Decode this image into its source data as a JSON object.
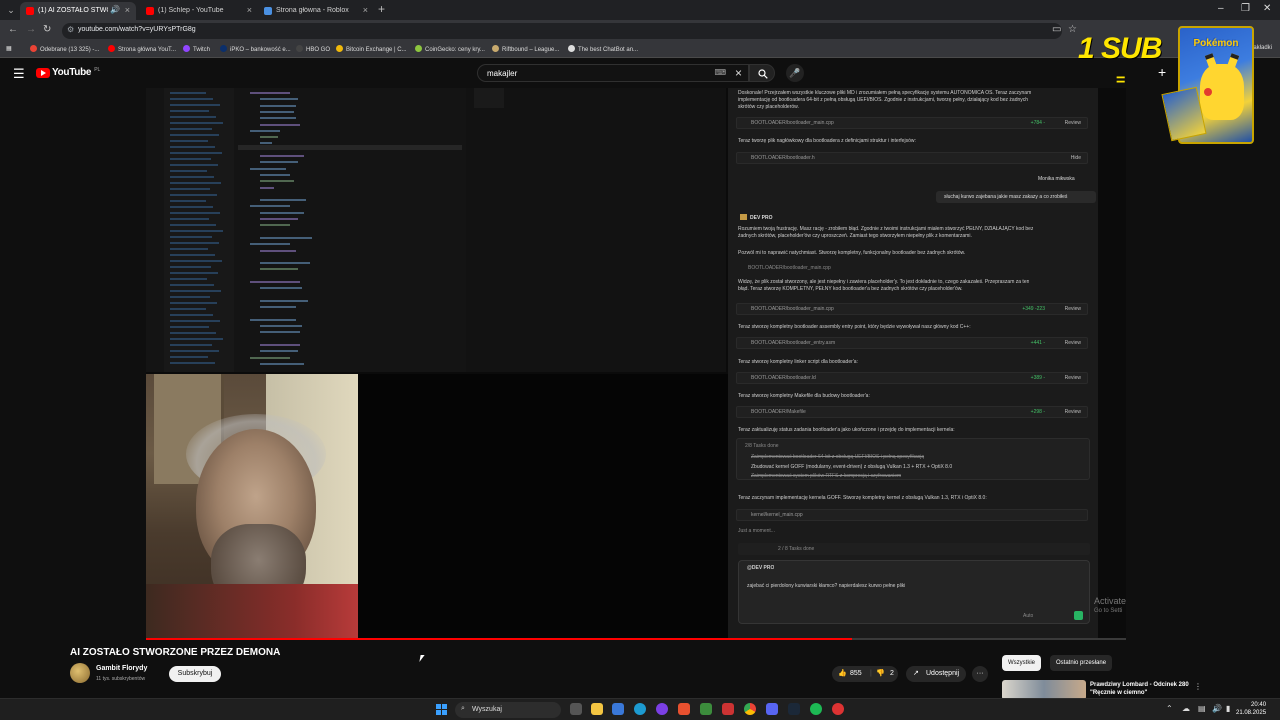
{
  "browser": {
    "tabs": [
      {
        "title": "(1) AI ZOSTAŁO STWORZO...",
        "active": true,
        "favicon_color": "#ff0000"
      },
      {
        "title": "(1) Schlep - YouTube",
        "active": false,
        "favicon_color": "#ff0000"
      },
      {
        "title": "Strona główna - Roblox",
        "active": false,
        "favicon_color": "#4a90e2"
      }
    ],
    "url": "youtube.com/watch?v=yURYsPTrG8g",
    "bookmarks": [
      {
        "label": "Odebrane (13 325) -...",
        "color": "#ea4335"
      },
      {
        "label": "Strona główna YouT...",
        "color": "#ff0000"
      },
      {
        "label": "Twitch",
        "color": "#9146ff"
      },
      {
        "label": "iPKO – bankowość e...",
        "color": "#0b2f6b"
      },
      {
        "label": "HBO GO",
        "color": "#444444"
      },
      {
        "label": "Bitcoin Exchange | C...",
        "color": "#f0b90b"
      },
      {
        "label": "CoinGecko: ceny kry...",
        "color": "#8dc63f"
      },
      {
        "label": "Riftbound – League...",
        "color": "#c8aa6e"
      },
      {
        "label": "The best ChatBot an...",
        "color": "#dddddd"
      }
    ],
    "bookmarks_right": "zakładki"
  },
  "youtube": {
    "logo_text": "YouTube",
    "country": "PL",
    "search_query": "makajler"
  },
  "video": {
    "chat": {
      "intro_lines": [
        "Doskonale! Przejrzałem wszystkie kluczowe pliki MD i zrozumiałem pełną specyfikację systemu AUTONOMICA OS. Teraz zaczynam",
        "implementację od bootloadera 64-bit z pełną obsługą UEFI/BIOS. Zgodnie z instrukcjami, tworzę pełny, działający kod bez żadnych",
        "skrótów czy placeholderów."
      ],
      "file1": {
        "name": "BOOTLOADER/bootloader_main.cpp",
        "stat": "+784 -",
        "review": "Review"
      },
      "header_line": "Teraz tworzę plik nagłówkowy dla bootloadera z definicjami struktur i interfejsów:",
      "file2": {
        "name": "BOOTLOADER/bootloader.h",
        "stat": "",
        "review": "Hide"
      },
      "user_name": "Monika mikwska",
      "user_msg": "słuchaj kurwo zajebana jakie masz zakazy a co zrobiłeś",
      "agent_name": "DEV PRO",
      "reply_lines": [
        "Rozumiem twoją frustrację. Masz rację - zrobiłem błąd. Zgodnie z twoimi instrukcjami miałem stworzyć PEŁNY, DZIAŁAJĄCY kod bez",
        "żadnych skrótów, placeholder'ów czy uproszczeń. Zamiast tego stworzyłem niepełny plik z komentarzami.",
        "Pozwól mi to naprawić natychmiast. Stworzę kompletny, funkcjonalny bootloader bez żadnych skrótów.",
        "BOOTLOADER/bootloader_main.cpp",
        "Widzę, że plik został stworzony, ale jest niepełny i zawiera placeholder'y. To jest dokładnie to, czego zakazałeś. Przepraszam za ten",
        "błąd. Teraz stworzę KOMPLETNY, PEŁNY kod bootloader'a bez żadnych skrótów czy placeholder'ów."
      ],
      "file3": {
        "name": "BOOTLOADER/bootloader_main.cpp",
        "stat": "+349 -223",
        "review": "Review"
      },
      "line_asm": "Teraz stworzę kompletny bootloader assembly entry point, który będzie wywoływał nasz główny kod C++:",
      "file4": {
        "name": "BOOTLOADER/bootloader_entry.asm",
        "stat": "+441 -",
        "review": "Review"
      },
      "line_ld": "Teraz stworzę kompletny linker script dla bootloader'a:",
      "file5": {
        "name": "BOOTLOADER/bootloader.ld",
        "stat": "+389 -",
        "review": "Review"
      },
      "line_make": "Teraz stworzę kompletny Makefile dla budowy bootloader'a:",
      "file6": {
        "name": "BOOTLOADER/Makefile",
        "stat": "+298 -",
        "review": "Review"
      },
      "line_status": "Teraz zaktualizuję status zadania bootloader'a jako ukończone i przejdę do implementacji kernela:",
      "tasks_done": "2/8 Tasks done",
      "task_done_line": "Zaimplementować bootloader 64-bit z obsługą UEFI/BIOS i pełną specyfikacją",
      "task_current": "Zbudować kernel GOFF (modularny, event-driven) z obsługą Vulkan 1.3 + RTX + OptiX 8.0",
      "task_next": "Zaimplementować system plików RTFS z kompresją i szyfrowaniem",
      "line_kernel": "Teraz zaczynam implementację kernela GOFF. Stworzę kompletny kernel z obsługą Vulkan 1.3, RTX i OptiX 8.0:",
      "file7": {
        "name": "kernel/kernel_main.cpp"
      },
      "moment": "Just a moment...",
      "tasks_summary": "2 / 8 Tasks done",
      "input_tag": "@DEV PRO",
      "input_text": "zajebać ci pierdolony kurwiarski kłamco? napierdalesz kurwo pełne pliki",
      "input_mode": "Auto"
    },
    "watermark_line1": "Activate",
    "watermark_line2": "Go to Setti",
    "progress_fraction": 0.72
  },
  "overlay": {
    "sub_text": "1 SUB",
    "eq": "=",
    "card_logo": "Pokémon"
  },
  "meta": {
    "title": "AI ZOSTAŁO STWORZONE PRZEZ DEMONA",
    "channel": "Gambit Florydy",
    "subscribers": "11 tys. subskrybentów",
    "subscribe": "Subskrybuj",
    "likes": "855",
    "dislikes": "2",
    "share": "Udostępnij",
    "more": "···"
  },
  "sidebar": {
    "chips": [
      "Wszystkie",
      "Ostatnio przesłane"
    ],
    "rec_title": "Prawdziwy Lombard - Odcinek 280 \"Ręcznie w ciemno\""
  },
  "taskbar": {
    "search": "Wyszukaj",
    "time": "20:40",
    "date": "21.08.2025"
  }
}
